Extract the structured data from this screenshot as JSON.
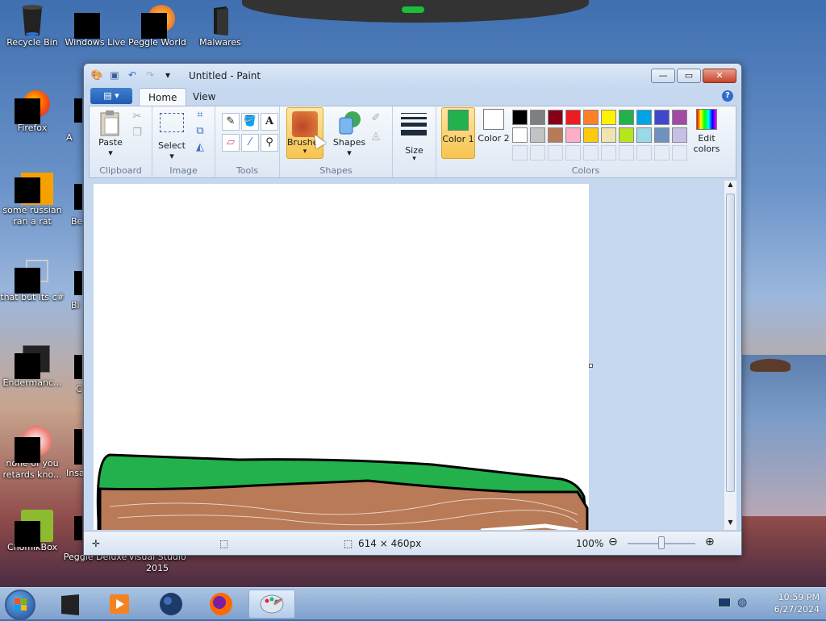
{
  "desktop": {
    "icons": [
      {
        "label": "Recycle Bin",
        "icon": "recycle-bin-icon"
      },
      {
        "label": "Windows Live",
        "icon": "windows-live-icon"
      },
      {
        "label": "Peggle World",
        "icon": "peggle-icon"
      },
      {
        "label": "Malwares",
        "icon": "folder-icon"
      },
      {
        "label": "Firefox",
        "icon": "firefox-icon"
      },
      {
        "label": "some russian ran a rat",
        "icon": "app-icon"
      },
      {
        "label": "that but its c#",
        "icon": "shortcut-icon"
      },
      {
        "label": "Endermanc...",
        "icon": "app-icon"
      },
      {
        "label": "none of you retards kno...",
        "icon": "app-icon"
      },
      {
        "label": "ChomikBox",
        "icon": "chomikbox-icon"
      },
      {
        "label": "Peggle Deluxe",
        "icon": "peggle-icon"
      },
      {
        "label": "Visual Studio 2015",
        "icon": "visual-studio-icon"
      }
    ],
    "partial_labels": [
      "A",
      "Be",
      "Bi",
      "C",
      "Insa"
    ]
  },
  "window": {
    "title": "Untitled - Paint",
    "buttons": {
      "minimize": "—",
      "maximize": "▭",
      "close": "✕"
    }
  },
  "ribbon": {
    "file_tab": "▤ ▾",
    "tabs": [
      {
        "label": "Home",
        "active": true
      },
      {
        "label": "View",
        "active": false
      }
    ],
    "help": "?",
    "groups": {
      "clipboard": {
        "label": "Clipboard",
        "paste": "Paste"
      },
      "image": {
        "label": "Image",
        "select": "Select"
      },
      "tools": {
        "label": "Tools"
      },
      "brushes": {
        "label": "Brushes"
      },
      "shapes": {
        "label": "Shapes",
        "button": "Shapes"
      },
      "size": {
        "label": "Size"
      },
      "colors": {
        "label": "Colors",
        "color1": "Color 1",
        "color2": "Color 2",
        "edit": "Edit colors",
        "color1_value": "#22b14c",
        "color2_value": "#ffffff",
        "palette_row1": [
          "#000000",
          "#7f7f7f",
          "#880015",
          "#ed1c24",
          "#ff7f27",
          "#fff200",
          "#22b14c",
          "#00a2e8",
          "#3f48cc",
          "#a349a4"
        ],
        "palette_row2": [
          "#ffffff",
          "#c3c3c3",
          "#b97a57",
          "#ffaec9",
          "#ffc90e",
          "#efe4b0",
          "#b5e61d",
          "#99d9ea",
          "#7092be",
          "#c8bfe7"
        ]
      }
    }
  },
  "status": {
    "dimensions": "614 × 460px",
    "zoom": "100%"
  },
  "taskbar": {
    "time": "10:59 PM",
    "date": "6/27/2024"
  }
}
